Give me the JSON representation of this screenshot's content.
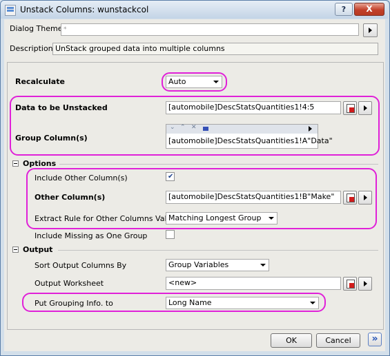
{
  "window": {
    "title": "Unstack Columns: wunstackcol",
    "help_label": "?",
    "close_label": "X"
  },
  "theme": {
    "label": "Dialog Theme",
    "value": "*",
    "description_label": "Description",
    "description": "UnStack grouped data into multiple columns"
  },
  "recalculate": {
    "label": "Recalculate",
    "value": "Auto"
  },
  "data": {
    "label": "Data to be Unstacked",
    "value": "[automobile]DescStatsQuantities1!4:5"
  },
  "group": {
    "label": "Group Column(s)",
    "value": "[automobile]DescStatsQuantities1!A\"Data\""
  },
  "options": {
    "header": "Options",
    "include_other_label": "Include Other Column(s)",
    "include_other_checked": true,
    "other_label": "Other Column(s)",
    "other_value": "[automobile]DescStatsQuantities1!B\"Make\"",
    "extract_label": "Extract Rule for Other Columns Values",
    "extract_value": "Matching Longest Group",
    "missing_label": "Include Missing as One Group",
    "missing_checked": false
  },
  "output": {
    "header": "Output",
    "sort_label": "Sort Output Columns By",
    "sort_value": "Group Variables",
    "worksheet_label": "Output Worksheet",
    "worksheet_value": "<new>",
    "grouping_label": "Put Grouping Info. to",
    "grouping_value": "Long Name"
  },
  "buttons": {
    "ok": "OK",
    "cancel": "Cancel",
    "expand": "»"
  },
  "colors": {
    "highlight": "#e020d8",
    "check": "#1b3f8b"
  }
}
